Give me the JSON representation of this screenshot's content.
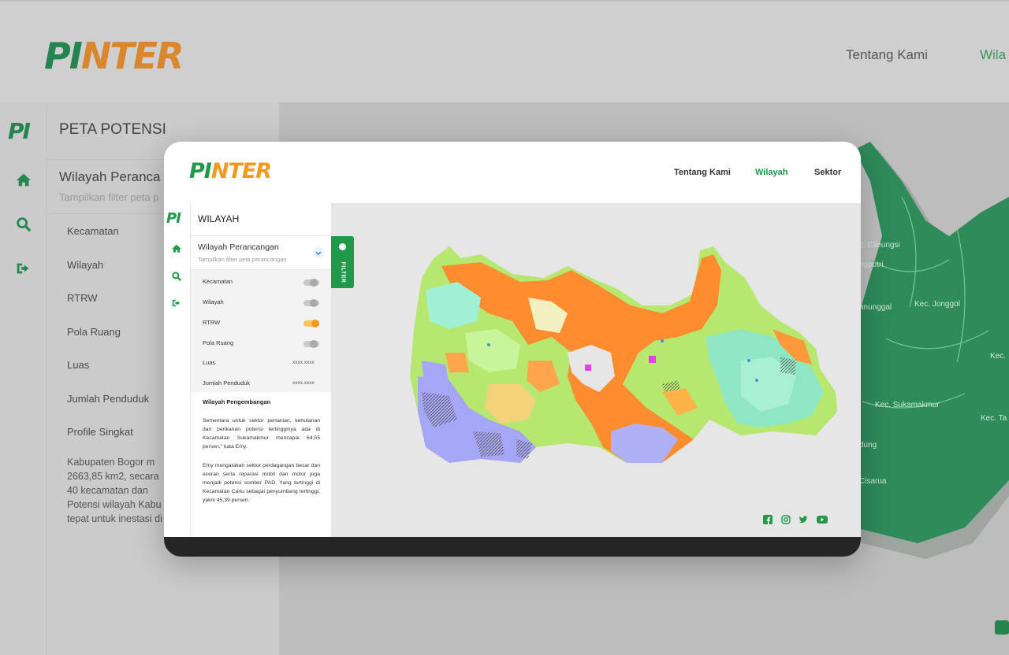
{
  "brand": {
    "logo_pi": "PI",
    "logo_nter": "NTER",
    "rail_logo": "PI"
  },
  "background": {
    "nav": [
      "Tentang Kami",
      "Wila"
    ],
    "sidebar_title": "PETA POTENSI",
    "section_title": "Wilayah Peranca",
    "section_subtitle": "Tampilkan filter peta p",
    "items": [
      "Kecamatan",
      "Wilayah",
      "RTRW",
      "Pola Ruang",
      "Luas",
      "Jumlah Penduduk",
      "Profile Singkat"
    ],
    "paragraph": "Kabupaten Bogor m 2663,85 km2, secara 40 kecamatan dan Potensi wilayah Kabu tepat untuk inestasi di",
    "map_labels": [
      "c. Cileungsi",
      "ngputri",
      "anunggal",
      "Kec. Jonggol",
      "Kec.",
      "Kec. Sukamakmur",
      "dung",
      "Kec. Ta",
      "Cisarua"
    ]
  },
  "card": {
    "nav": {
      "about": "Tentang Kami",
      "region": "Wilayah",
      "sector": "Sektor"
    },
    "panel_title": "WILAYAH",
    "section_title": "Wilayah Perancangan",
    "section_subtitle": "Tampilkan filter peta perancangan",
    "rows": {
      "kecamatan": "Kecamatan",
      "wilayah": "Wilayah",
      "rtrw": "RTRW",
      "pola_ruang": "Pola Ruang",
      "luas": "Luas",
      "luas_value": "xxxx.xxxx",
      "jumlah_penduduk": "Jumlah Penduduk",
      "jumlah_penduduk_value": "xxxx.xxxx"
    },
    "toggles": {
      "kecamatan": false,
      "wilayah": false,
      "rtrw": true,
      "pola_ruang": false
    },
    "profile_title": "Wilayah Pengembangan",
    "paragraph_1": "Sementara untuk sektor pertanian, kehutanan dan perikanan potensi tertingginya ada di Kecamatan Sukamakmur mencapai 64,55 persen,\" kata Emy.",
    "paragraph_2": "Emy mengatakan sektor perdagangan besar dan eceran serta reparasi mobil dan motor juga menjadi potensi sumber PAD. Yang tertinggi di Kecamatan Cariu sebagai penyumbang tertinggi, yakni 45,39 persen.",
    "filter_label": "FILTER"
  },
  "colors": {
    "brand_green": "#1e9a4a",
    "brand_orange": "#f29a1f",
    "footer": "#252525"
  },
  "icons": [
    "home-icon",
    "search-icon",
    "sign-out-icon",
    "chevron-down-icon",
    "facebook-icon",
    "instagram-icon",
    "twitter-icon",
    "youtube-icon"
  ]
}
